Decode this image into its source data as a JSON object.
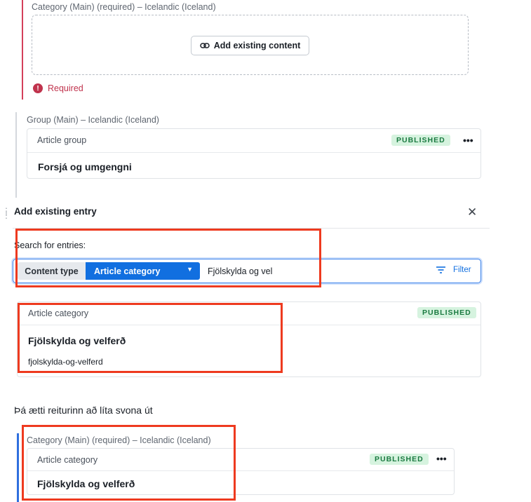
{
  "section_required": {
    "field_label": "Category (Main) (required) – Icelandic (Iceland)",
    "add_button_label": "Add existing content",
    "error_icon": "!",
    "error_text": "Required"
  },
  "section_group": {
    "field_label": "Group (Main) – Icelandic (Iceland)",
    "card": {
      "type": "Article group",
      "status": "PUBLISHED",
      "menu": "•••",
      "title": "Forsjá og umgengni"
    }
  },
  "modal": {
    "title": "Add existing entry",
    "close": "✕",
    "search_label": "Search for entries:",
    "content_type_label": "Content type",
    "content_type_value": "Article category",
    "caret": "▼",
    "query": "Fjölskylda og vel",
    "filter_label": "Filter",
    "result": {
      "type": "Article category",
      "status": "PUBLISHED",
      "title": "Fjölskylda og velferð",
      "slug": "fjolskylda-og-velferd"
    }
  },
  "caption": "Þá ætti reiturinn að líta svona út",
  "section_result": {
    "field_label": "Category (Main) (required) – Icelandic (Iceland)",
    "card": {
      "type": "Article category",
      "status": "PUBLISHED",
      "menu": "•••",
      "title": "Fjölskylda og velferð"
    }
  },
  "icons": [
    "link-icon",
    "error-icon",
    "drag-handle-icon",
    "close-icon",
    "caret-down-icon",
    "filter-icon",
    "more-icon"
  ],
  "colors": {
    "required_accent": "#d43f5a",
    "primary_blue": "#116fe0",
    "published_bg": "#d6f3df",
    "published_text": "#1a7a40",
    "annotation_red": "#ee3a1f"
  }
}
